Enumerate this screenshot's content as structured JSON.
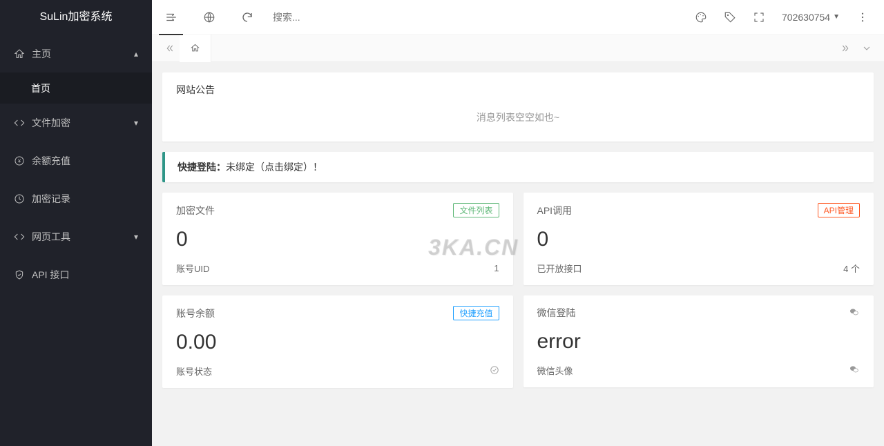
{
  "app": {
    "title": "SuLin加密系统"
  },
  "sidebar": {
    "items": [
      {
        "label": "主页",
        "expanded": true
      },
      {
        "label": "首页"
      },
      {
        "label": "文件加密"
      },
      {
        "label": "余额充值"
      },
      {
        "label": "加密记录"
      },
      {
        "label": "网页工具"
      },
      {
        "label": "API 接口"
      }
    ]
  },
  "header": {
    "search_placeholder": "搜索...",
    "user_id": "702630754"
  },
  "announcement": {
    "title": "网站公告",
    "empty": "消息列表空空如也~"
  },
  "alert": {
    "label": "快捷登陆：",
    "text": "未绑定（点击绑定）！"
  },
  "cards": {
    "encrypt": {
      "title": "加密文件",
      "badge": "文件列表",
      "value": "0",
      "footer_label": "账号UID",
      "footer_value": "1"
    },
    "api": {
      "title": "API调用",
      "badge": "API管理",
      "value": "0",
      "footer_label": "已开放接口",
      "footer_value": "4 个"
    },
    "balance": {
      "title": "账号余额",
      "badge": "快捷充值",
      "value": "0.00",
      "footer_label": "账号状态"
    },
    "wechat": {
      "title": "微信登陆",
      "value": "error",
      "footer_label": "微信头像"
    }
  },
  "watermark": "3KA.CN"
}
